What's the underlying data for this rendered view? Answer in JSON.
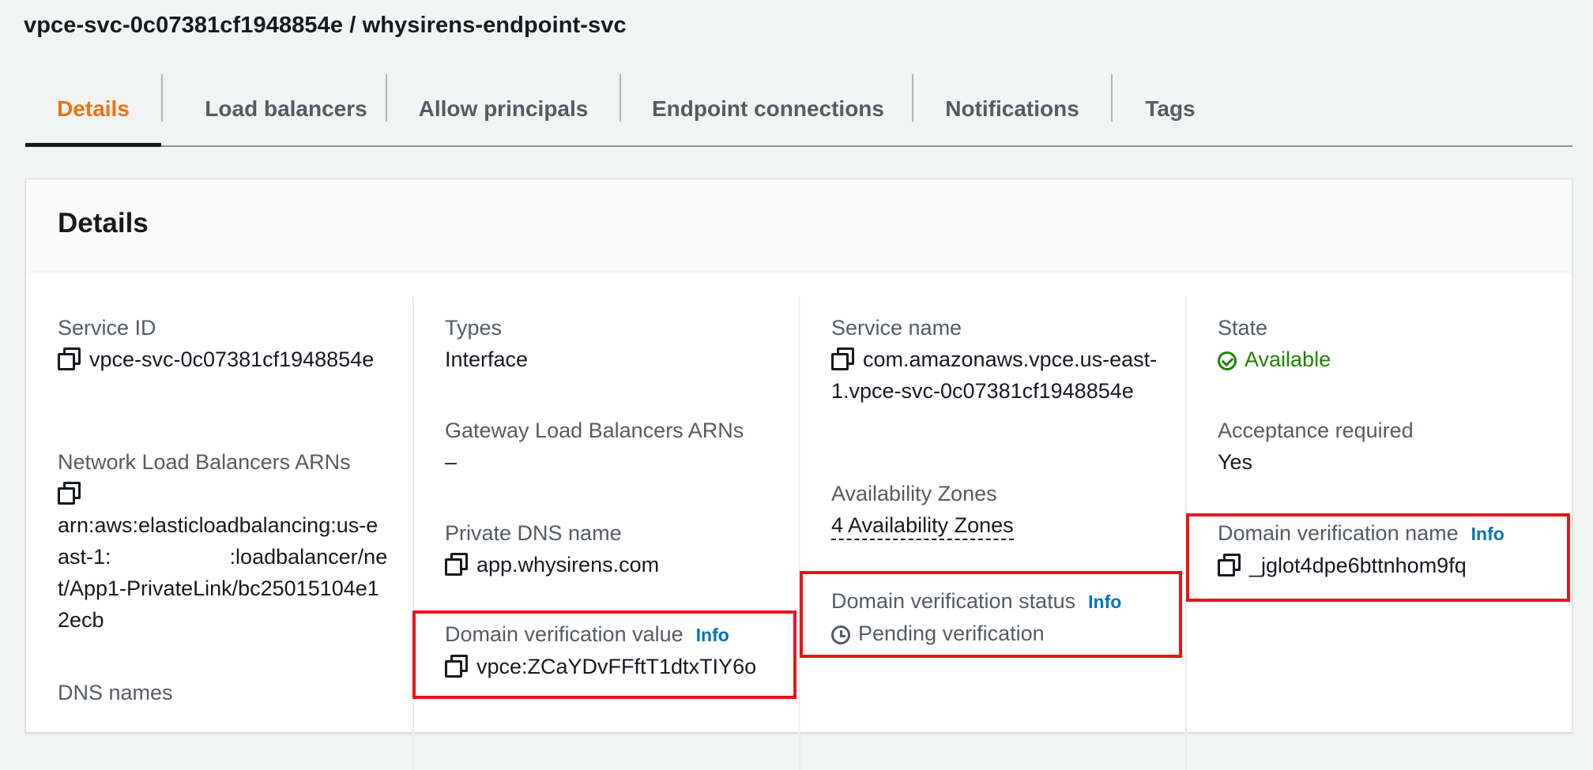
{
  "header": {
    "title": "vpce-svc-0c07381cf1948854e / whysirens-endpoint-svc"
  },
  "tabs": [
    {
      "label": "Details"
    },
    {
      "label": "Load balancers"
    },
    {
      "label": "Allow principals"
    },
    {
      "label": "Endpoint connections"
    },
    {
      "label": "Notifications"
    },
    {
      "label": "Tags"
    }
  ],
  "active_tab": "Details",
  "panel": {
    "title": "Details",
    "service_id": {
      "label": "Service ID",
      "value": "vpce-svc-0c07381cf1948854e"
    },
    "nlb_arns": {
      "label": "Network Load Balancers ARNs",
      "value": "arn:aws:elasticloadbalancing:us-east-1:                    :loadbalancer/net/App1-PrivateLink/bc25015104e12ecb"
    },
    "dns_names": {
      "label": "DNS names"
    },
    "types": {
      "label": "Types",
      "value": "Interface"
    },
    "gwlb_arns": {
      "label": "Gateway Load Balancers ARNs",
      "value": "–"
    },
    "private_dns": {
      "label": "Private DNS name",
      "value": "app.whysirens.com"
    },
    "domain_verification_value": {
      "label": "Domain verification value",
      "info": "Info",
      "value": "vpce:ZCaYDvFFftT1dtxTIY6o"
    },
    "service_name": {
      "label": "Service name",
      "value": "com.amazonaws.vpce.us-east-1.vpce-svc-0c07381cf1948854e"
    },
    "availability_zones": {
      "label": "Availability Zones",
      "value": "4 Availability Zones"
    },
    "domain_verification_status": {
      "label": "Domain verification status",
      "info": "Info",
      "value": "Pending verification"
    },
    "state": {
      "label": "State",
      "value": "Available"
    },
    "acceptance_required": {
      "label": "Acceptance required",
      "value": "Yes"
    },
    "domain_verification_name": {
      "label": "Domain verification name",
      "info": "Info",
      "value": "_jglot4dpe6bttnhom9fq"
    }
  },
  "colors": {
    "active_tab": "#ec7211",
    "link": "#0073bb",
    "status_available": "#1d8102",
    "highlight_box": "#e8141c"
  },
  "icons": {
    "copy": "copy-icon",
    "available": "check-circle-icon",
    "pending": "clock-icon"
  }
}
